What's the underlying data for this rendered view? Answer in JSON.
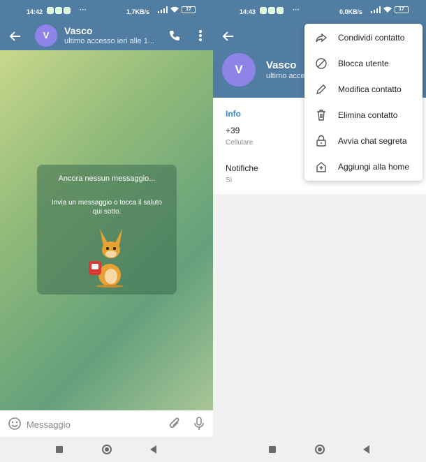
{
  "colors": {
    "header": "#517da2",
    "accent": "#3a8bd1",
    "avatar": "#8e83e6"
  },
  "left": {
    "status": {
      "time": "14:42",
      "speed": "1,7KB/s",
      "battery": "17"
    },
    "header": {
      "avatar_letter": "V",
      "name": "Vasco",
      "last_seen": "ultimo accesso ieri alle 1..."
    },
    "chat": {
      "empty_title": "Ancora nessun messaggio...",
      "empty_hint": "Invia un messaggio o tocca il saluto qui sotto.",
      "sticker": "kangaroo-sticker"
    },
    "composer": {
      "placeholder": "Messaggio"
    }
  },
  "right": {
    "status": {
      "time": "14:43",
      "speed": "0,0KB/s",
      "battery": "17"
    },
    "profile": {
      "avatar_letter": "V",
      "name": "Vasco",
      "status": "ultimo access"
    },
    "info": {
      "header": "Info",
      "phone": "+39",
      "phone_label": "Cellulare",
      "notifications": "Notifiche",
      "notifications_value": "Sì"
    },
    "menu": [
      {
        "label": "Condividi contatto",
        "icon": "share-icon"
      },
      {
        "label": "Blocca utente",
        "icon": "block-icon"
      },
      {
        "label": "Modifica contatto",
        "icon": "pencil-icon"
      },
      {
        "label": "Elimina contatto",
        "icon": "trash-icon"
      },
      {
        "label": "Avvia chat segreta",
        "icon": "lock-icon"
      },
      {
        "label": "Aggiungi alla home",
        "icon": "add-home-icon"
      }
    ]
  }
}
